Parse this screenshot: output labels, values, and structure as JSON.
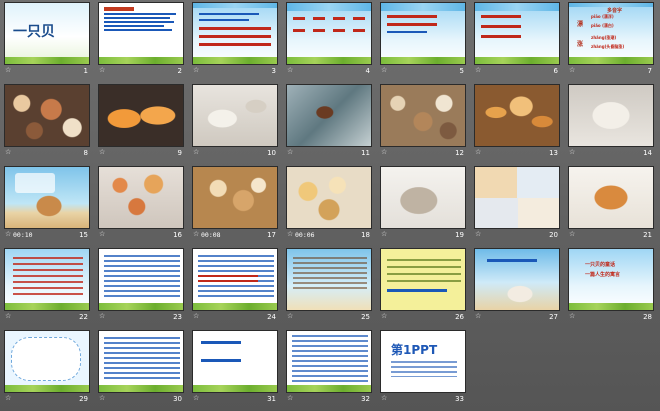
{
  "slides": [
    {
      "n": "1"
    },
    {
      "n": "2"
    },
    {
      "n": "3"
    },
    {
      "n": "4"
    },
    {
      "n": "5"
    },
    {
      "n": "6"
    },
    {
      "n": "7"
    },
    {
      "n": "8"
    },
    {
      "n": "9"
    },
    {
      "n": "10"
    },
    {
      "n": "11"
    },
    {
      "n": "12"
    },
    {
      "n": "13"
    },
    {
      "n": "14"
    },
    {
      "n": "15",
      "timing": "00:10"
    },
    {
      "n": "16"
    },
    {
      "n": "17",
      "timing": "00:08"
    },
    {
      "n": "18",
      "timing": "00:06"
    },
    {
      "n": "19"
    },
    {
      "n": "20"
    },
    {
      "n": "21"
    },
    {
      "n": "22"
    },
    {
      "n": "23"
    },
    {
      "n": "24"
    },
    {
      "n": "25"
    },
    {
      "n": "26"
    },
    {
      "n": "27"
    },
    {
      "n": "28"
    },
    {
      "n": "29"
    },
    {
      "n": "30"
    },
    {
      "n": "31"
    },
    {
      "n": "32"
    },
    {
      "n": "33"
    }
  ],
  "slide1": {
    "title": "一只贝"
  },
  "slide7": {
    "heading": "多音字",
    "line1": "piāo (漂浮)",
    "line2": "piǎo (漂白)",
    "line3": "zhǎng(涨潮)",
    "line4": "zhàng(头昏脑涨)",
    "char1": "漂",
    "char2": "涨"
  },
  "slide28": {
    "line1": "一只贝的童话",
    "line2": "一篇人生的寓言"
  },
  "slide33": {
    "logo": "第1PPT"
  },
  "colors": {
    "background": "#5f5f5f",
    "accent_red": "#c0281a",
    "accent_blue": "#1a58b8"
  }
}
